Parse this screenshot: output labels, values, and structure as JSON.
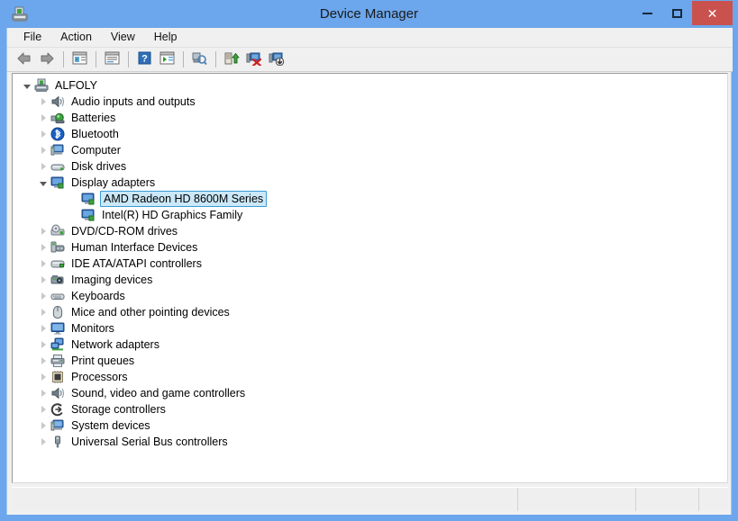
{
  "window": {
    "title": "Device Manager",
    "icon": "device-manager-icon",
    "frame_color": "#6ca6ec",
    "caption": {
      "minimize_label": "–",
      "maximize_label": "□",
      "close_label": "✕",
      "close_color": "#c9524f"
    }
  },
  "menubar": {
    "items": [
      {
        "label": "File"
      },
      {
        "label": "Action"
      },
      {
        "label": "View"
      },
      {
        "label": "Help"
      }
    ]
  },
  "toolbar": {
    "buttons": [
      {
        "name": "back-arrow-icon",
        "tooltip": "Back"
      },
      {
        "name": "forward-arrow-icon",
        "tooltip": "Forward"
      },
      {
        "name": "separator-1",
        "type": "separator"
      },
      {
        "name": "show-hide-console-tree-icon",
        "tooltip": "Show/Hide Console Tree"
      },
      {
        "name": "separator-2",
        "type": "separator"
      },
      {
        "name": "properties-icon",
        "tooltip": "Properties"
      },
      {
        "name": "separator-3",
        "type": "separator"
      },
      {
        "name": "help-icon",
        "tooltip": "Help"
      },
      {
        "name": "show-hide-action-pane-icon",
        "tooltip": "Show/Hide Action Pane"
      },
      {
        "name": "separator-4",
        "type": "separator"
      },
      {
        "name": "scan-for-hardware-changes-icon",
        "tooltip": "Scan for hardware changes"
      },
      {
        "name": "separator-5",
        "type": "separator"
      },
      {
        "name": "update-driver-icon",
        "tooltip": "Update Driver Software"
      },
      {
        "name": "disable-device-icon",
        "tooltip": "Disable"
      },
      {
        "name": "uninstall-device-icon",
        "tooltip": "Uninstall"
      }
    ]
  },
  "tree": {
    "selected_item": "AMD Radeon HD 8600M Series",
    "selection_fill": "#cbe8f8",
    "selection_border": "#3c9bd4",
    "nodes": [
      {
        "label": "ALFOLY",
        "level": 0,
        "state": "expanded",
        "icon": "computer-host-icon"
      },
      {
        "label": "Audio inputs and outputs",
        "level": 1,
        "state": "collapsed",
        "icon": "speaker-icon"
      },
      {
        "label": "Batteries",
        "level": 1,
        "state": "collapsed",
        "icon": "battery-icon"
      },
      {
        "label": "Bluetooth",
        "level": 1,
        "state": "collapsed",
        "icon": "bluetooth-icon"
      },
      {
        "label": "Computer",
        "level": 1,
        "state": "collapsed",
        "icon": "computer-icon"
      },
      {
        "label": "Disk drives",
        "level": 1,
        "state": "collapsed",
        "icon": "disk-drive-icon"
      },
      {
        "label": "Display adapters",
        "level": 1,
        "state": "expanded",
        "icon": "display-adapter-icon"
      },
      {
        "label": "AMD Radeon HD 8600M Series",
        "level": 2,
        "state": "leaf",
        "icon": "display-adapter-icon",
        "selected": true
      },
      {
        "label": "Intel(R) HD Graphics Family",
        "level": 2,
        "state": "leaf",
        "icon": "display-adapter-icon"
      },
      {
        "label": "DVD/CD-ROM drives",
        "level": 1,
        "state": "collapsed",
        "icon": "dvd-drive-icon"
      },
      {
        "label": "Human Interface Devices",
        "level": 1,
        "state": "collapsed",
        "icon": "hid-icon"
      },
      {
        "label": "IDE ATA/ATAPI controllers",
        "level": 1,
        "state": "collapsed",
        "icon": "ide-controller-icon"
      },
      {
        "label": "Imaging devices",
        "level": 1,
        "state": "collapsed",
        "icon": "camera-icon"
      },
      {
        "label": "Keyboards",
        "level": 1,
        "state": "collapsed",
        "icon": "keyboard-icon"
      },
      {
        "label": "Mice and other pointing devices",
        "level": 1,
        "state": "collapsed",
        "icon": "mouse-icon"
      },
      {
        "label": "Monitors",
        "level": 1,
        "state": "collapsed",
        "icon": "monitor-icon"
      },
      {
        "label": "Network adapters",
        "level": 1,
        "state": "collapsed",
        "icon": "network-adapter-icon"
      },
      {
        "label": "Print queues",
        "level": 1,
        "state": "collapsed",
        "icon": "printer-icon"
      },
      {
        "label": "Processors",
        "level": 1,
        "state": "collapsed",
        "icon": "processor-icon"
      },
      {
        "label": "Sound, video and game controllers",
        "level": 1,
        "state": "collapsed",
        "icon": "speaker-icon"
      },
      {
        "label": "Storage controllers",
        "level": 1,
        "state": "collapsed",
        "icon": "storage-controller-icon"
      },
      {
        "label": "System devices",
        "level": 1,
        "state": "collapsed",
        "icon": "computer-icon"
      },
      {
        "label": "Universal Serial Bus controllers",
        "level": 1,
        "state": "collapsed",
        "icon": "usb-icon"
      }
    ]
  },
  "statusbar": {
    "cells": [
      "",
      "",
      "",
      ""
    ]
  }
}
